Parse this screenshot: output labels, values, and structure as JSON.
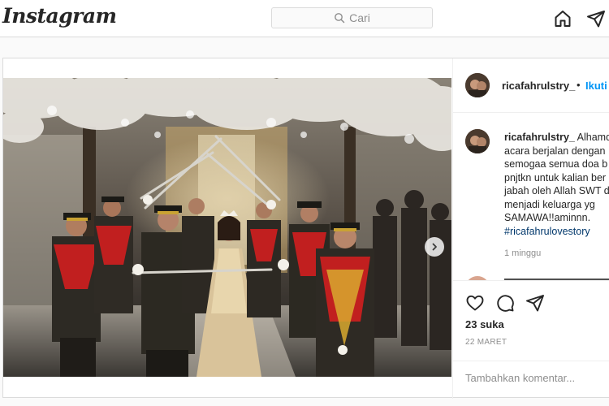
{
  "app": {
    "logo_text": "Instagram"
  },
  "search": {
    "placeholder": "Cari",
    "icon": "search-icon"
  },
  "nav": {
    "icons": [
      "home-icon",
      "direct-message-icon"
    ]
  },
  "post": {
    "username": "ricafahrulstry_",
    "dot": "•",
    "follow_label": "Ikuti",
    "caption": {
      "username": "ricafahrulstry_",
      "lines": [
        "Alhamd",
        "acara berjalan dengan",
        "semogaa semua doa b",
        "pnjtkn untuk kalian ber",
        "jabah oleh Allah SWT d",
        "menjadi keluarga yg",
        "SAMAWA!!aminnn."
      ],
      "hashtag": "#ricafahrulovestory",
      "time": "1 minggu"
    },
    "likes": "23 suka",
    "date": "22 MARET",
    "comment_placeholder": "Tambahkan komentar...",
    "actions": [
      "heart-icon",
      "comment-icon",
      "share-icon"
    ]
  },
  "colors": {
    "accent": "#0095f6",
    "hashtag": "#00376b",
    "border": "#dbdbdb",
    "muted": "#8e8e8e"
  }
}
